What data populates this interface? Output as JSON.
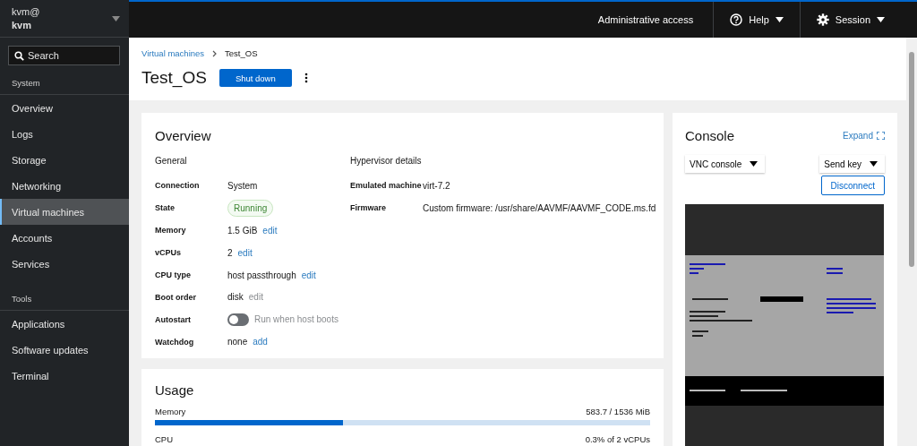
{
  "sidebar": {
    "user": "kvm@",
    "host": "kvm",
    "search": {
      "placeholder": "Search"
    },
    "sections": [
      {
        "title": "System",
        "items": [
          {
            "label": "Overview",
            "selected": false
          },
          {
            "label": "Logs",
            "selected": false
          },
          {
            "label": "Storage",
            "selected": false
          },
          {
            "label": "Networking",
            "selected": false
          },
          {
            "label": "Virtual machines",
            "selected": true
          },
          {
            "label": "Accounts",
            "selected": false
          },
          {
            "label": "Services",
            "selected": false
          }
        ]
      },
      {
        "title": "Tools",
        "items": [
          {
            "label": "Applications",
            "selected": false
          },
          {
            "label": "Software updates",
            "selected": false
          },
          {
            "label": "Terminal",
            "selected": false
          }
        ]
      }
    ]
  },
  "topbar": {
    "admin": "Administrative access",
    "help": "Help",
    "session": "Session"
  },
  "breadcrumb": {
    "parent": "Virtual machines",
    "current": "Test_OS"
  },
  "page_title": "Test_OS",
  "primary_button": "Shut down",
  "overview": {
    "title": "Overview",
    "general": {
      "heading": "General",
      "rows": [
        {
          "label": "Connection",
          "kind": "text",
          "value": "System"
        },
        {
          "label": "State",
          "kind": "badge",
          "value": "Running"
        },
        {
          "label": "Memory",
          "kind": "text",
          "value": "1.5 GiB",
          "action": "edit",
          "action_disabled": false
        },
        {
          "label": "vCPUs",
          "kind": "text",
          "value": "2",
          "action": "edit",
          "action_disabled": false
        },
        {
          "label": "CPU type",
          "kind": "text",
          "value": "host passthrough",
          "action": "edit",
          "action_disabled": false
        },
        {
          "label": "Boot order",
          "kind": "text",
          "value": "disk",
          "action": "edit",
          "action_disabled": true
        },
        {
          "label": "Autostart",
          "kind": "toggle",
          "value": "Run when host boots",
          "on": false
        },
        {
          "label": "Watchdog",
          "kind": "text",
          "value": "none",
          "action": "add",
          "action_disabled": false
        }
      ]
    },
    "hypervisor": {
      "heading": "Hypervisor details",
      "rows": [
        {
          "label": "Emulated machine",
          "kind": "text",
          "value": "virt-7.2"
        },
        {
          "label": "Firmware",
          "kind": "text",
          "value": "Custom firmware: /usr/share/AAVMF/AAVMF_CODE.ms.fd"
        }
      ]
    }
  },
  "console": {
    "title": "Console",
    "expand": "Expand",
    "type_select": "VNC console",
    "send_key": "Send key",
    "disconnect": "Disconnect"
  },
  "usage": {
    "title": "Usage",
    "meters": [
      {
        "label": "Memory",
        "reading": "583.7 / 1536 MiB",
        "level": 0.38
      },
      {
        "label": "CPU",
        "reading": "0.3% of 2 vCPUs"
      }
    ]
  }
}
